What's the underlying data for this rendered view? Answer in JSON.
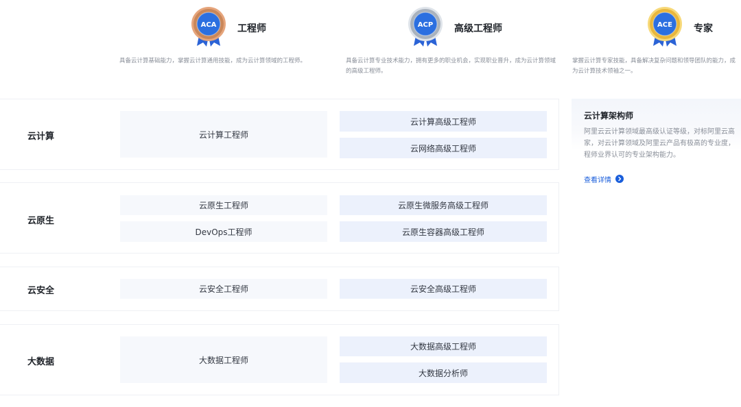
{
  "levels": [
    {
      "badge": "ACA",
      "title": "工程师",
      "description": "具备云计算基础能力，掌握云计算通用技能，成为云计算领域的工程师。",
      "medal_color": "#c9875a"
    },
    {
      "badge": "ACP",
      "title": "高级工程师",
      "description": "具备云计算专业技术能力，拥有更多的职业机会，实现职业晋升，成为云计算领域的高级工程师。",
      "medal_color": "#a9b2bd"
    },
    {
      "badge": "ACE",
      "title": "专家",
      "description": "掌握云计算专家技能，具备解决复杂问题和领导团队的能力，成为云计算技术领袖之一。",
      "medal_color": "#e8b63c"
    }
  ],
  "tracks": [
    {
      "name": "云计算",
      "engineer": [
        "云计算工程师"
      ],
      "senior": [
        "云计算高级工程师",
        "云网络高级工程师"
      ]
    },
    {
      "name": "云原生",
      "engineer": [
        "云原生工程师",
        "DevOps工程师"
      ],
      "senior": [
        "云原生微服务高级工程师",
        "云原生容器高级工程师"
      ]
    },
    {
      "name": "云安全",
      "engineer": [
        "云安全工程师"
      ],
      "senior": [
        "云安全高级工程师"
      ]
    },
    {
      "name": "大数据",
      "engineer": [
        "大数据工程师"
      ],
      "senior": [
        "大数据高级工程师",
        "大数据分析师"
      ]
    }
  ],
  "expert": {
    "title": "云计算架构师",
    "description": [
      "阿里云云计算领域最高级认证等级，对标阿里云高",
      "家，对云计算领域及阿里云产品有极高的专业度，",
      "程师业界认可的专业架构能力。"
    ],
    "link_label": "查看详情"
  },
  "colors": {
    "accent": "#1a5edb",
    "badge_blue": "#2b6fe0",
    "engineer_cell_bg": "#f6f8fc",
    "senior_cell_bg": "#ecf1fc"
  }
}
